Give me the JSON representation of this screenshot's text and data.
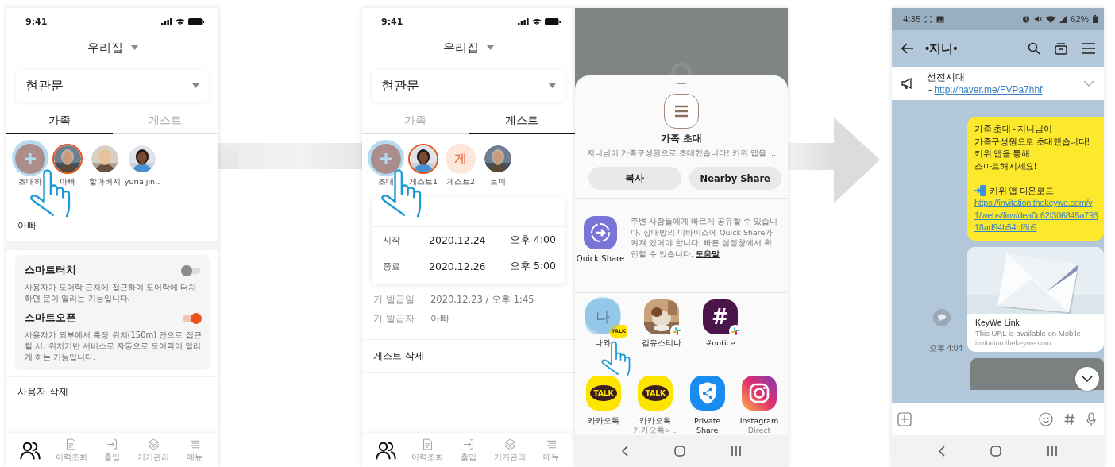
{
  "family_screen": {
    "status_bar": {
      "time": "9:41"
    },
    "home": "우리집",
    "door": "현관문",
    "tabs": [
      {
        "label": "가족",
        "selected": true
      },
      {
        "label": "게스트",
        "selected": false
      }
    ],
    "members": [
      {
        "kind": "invite",
        "name": "초대하",
        "selected": false
      },
      {
        "name": "아빠",
        "selected": true
      },
      {
        "name": "할아버지",
        "selected": false
      },
      {
        "name": "yuria jin..",
        "selected": false
      }
    ],
    "name_value": "아빠",
    "settings": [
      {
        "title": "스마트터치",
        "on": false,
        "description": "사용자가 도어락 근처에 접근하여 도어락에 터치하면 문이 열리는 기능입니다."
      },
      {
        "title": "스마트오픈",
        "on": true,
        "description": "사용자가 외부에서 특정 위치(150m) 안으로 접근할 시, 위치기반 서비스로 자동으로 도어락이 열리게 하는 기능입니다."
      }
    ],
    "delete_label": "사용자 삭제",
    "nav": [
      {
        "selected": true
      },
      {
        "label": "이력조회",
        "selected": false
      },
      {
        "label": "출입",
        "selected": false
      },
      {
        "label": "기기관리",
        "selected": false
      },
      {
        "label": "메뉴",
        "selected": false
      }
    ]
  },
  "guest_screen": {
    "status_bar": {
      "time": "9:41"
    },
    "home": "우리집",
    "door": "현관문",
    "tabs": [
      {
        "label": "가족",
        "selected": false
      },
      {
        "label": "게스트",
        "selected": true
      }
    ],
    "members": [
      {
        "kind": "invite",
        "name": "초대",
        "selected": false
      },
      {
        "name": "게스트1",
        "selected": true
      },
      {
        "kind": "initial",
        "initial": "게",
        "name": "게스트2",
        "selected": false
      },
      {
        "name": "토미",
        "selected": false
      }
    ],
    "period": [
      {
        "label": "시작",
        "date": "2020.12.24",
        "time": "오후 4:00"
      },
      {
        "label": "종료",
        "date": "2020.12.26",
        "time": "오후 5:00"
      }
    ],
    "info": [
      {
        "label": "키 발급일",
        "value": "2020.12.23 / 오후  1:45"
      },
      {
        "label": "키 발급자",
        "value": "아빠"
      }
    ],
    "delete_label": "게스트 삭제",
    "nav": [
      {
        "selected": true
      },
      {
        "label": "이력조회",
        "selected": false
      },
      {
        "label": "출입",
        "selected": false
      },
      {
        "label": "기기관리",
        "selected": false
      },
      {
        "label": "메뉴",
        "selected": false
      }
    ]
  },
  "share_sheet": {
    "title": "가족 초대",
    "preview": "지니님이 가족구성원으로 초대했습니다! 키위 앱을 ...",
    "buttons": [
      "복사",
      "Nearby Share"
    ],
    "quick_share": {
      "label": "Quick Share",
      "description": "주변 사람들에게 빠르게 공유할 수 있습니다. 상대방의 디바이스에 Quick Share가 켜져 있어야 합니다. 빠른 설정창에서 확인할 수 있습니다.",
      "link": "도움말"
    },
    "direct_share": [
      {
        "kind": "initial",
        "initial": "나",
        "label": "나와",
        "badge_text": "TALK"
      },
      {
        "label": "김유스티나"
      },
      {
        "kind": "hash",
        "initial": "#",
        "label": "#notice"
      }
    ],
    "apps": [
      {
        "kind": "kakao",
        "icon_text": "TALK",
        "label": "카카오톡"
      },
      {
        "kind": "kakao",
        "icon_text": "TALK",
        "label": "카카오톡",
        "sublabel": "카카오톡> .."
      },
      {
        "kind": "private",
        "label": "Private Share"
      },
      {
        "kind": "instagram",
        "label": "Instagram",
        "sublabel": "Direct"
      }
    ]
  },
  "chat_screen": {
    "status_bar": {
      "time": "4:35",
      "battery": "62%"
    },
    "title": "•지니•",
    "notice": {
      "title": "선전시대",
      "prefix": "- ",
      "link": "http://naver.me/FVPa7hhf"
    },
    "message": {
      "text": "가족 초대 - 지니님이\n가족구성원으로 초대했습니다!\n키위 앱을 통해\n스마트해지세요!",
      "download": "키위 앱 다운로드",
      "link": "https://invitation.thekeywe.com/v1/webs/finv/dea0c62f306845a79318ad94b54bf6b9"
    },
    "link_card": {
      "title": "KeyWe Link",
      "description": "This URL is available on Mobile",
      "domain": "invitation.thekeywe.com"
    },
    "time": "오후 4:04"
  }
}
